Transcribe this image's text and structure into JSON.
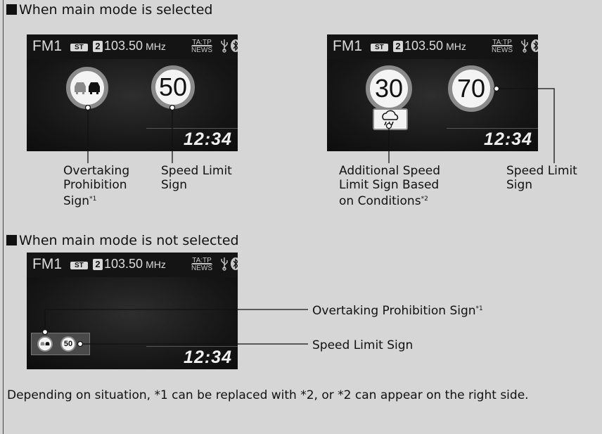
{
  "sections": {
    "main": {
      "heading": "When main mode is selected"
    },
    "not_main": {
      "heading": "When main mode is not selected"
    }
  },
  "status_bar": {
    "band": "FM1",
    "st_badge": "ST",
    "preset": "2",
    "frequency": "103.50",
    "unit": "MHz",
    "ta_tp": "TA:TP",
    "news": "NEWS"
  },
  "clock": "12:34",
  "signs": {
    "speed_50": "50",
    "speed_30": "30",
    "speed_70": "70",
    "small_speed_50": "50"
  },
  "captions": {
    "overtaking": {
      "line1": "Overtaking",
      "line2": "Prohibition",
      "line3": "Sign",
      "sup": "*1"
    },
    "speed_limit_left": {
      "line1": "Speed Limit",
      "line2": "Sign"
    },
    "additional": {
      "line1": "Additional Speed",
      "line2": "Limit Sign Based",
      "line3": "on Conditions",
      "sup": "*2"
    },
    "speed_limit_right": {
      "line1": "Speed Limit",
      "line2": "Sign"
    },
    "overtaking_inline": {
      "text": "Overtaking Prohibition Sign",
      "sup": "*1"
    },
    "speed_limit_inline": "Speed Limit Sign"
  },
  "note": "Depending on situation, *1 can be replaced with *2, or *2 can appear on the right side."
}
